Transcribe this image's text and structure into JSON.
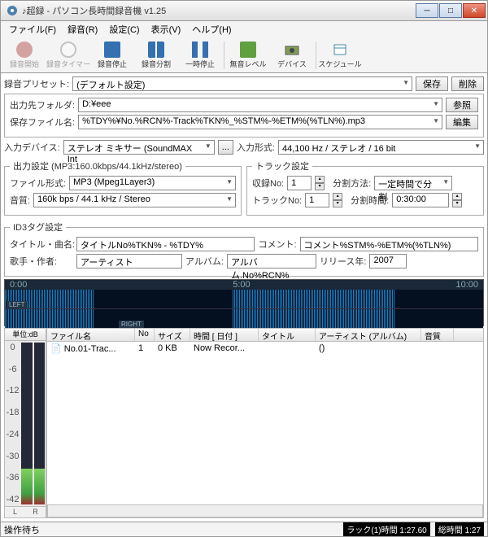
{
  "window": {
    "title": "♪超録 - パソコン長時間録音機 v1.25"
  },
  "menu": {
    "file": "ファイル(F)",
    "record": "録音(R)",
    "settings": "設定(C)",
    "view": "表示(V)",
    "help": "ヘルプ(H)"
  },
  "toolbar": {
    "rec_start": "録音開始",
    "rec_timer": "録音タイマー",
    "rec_stop": "録音停止",
    "rec_split": "録音分割",
    "pause": "一時停止",
    "silence": "無音レベル",
    "device": "デバイス",
    "schedule": "スケジュール"
  },
  "preset": {
    "label": "録音プリセット:",
    "value": "(デフォルト設定)",
    "save": "保存",
    "delete": "削除"
  },
  "output": {
    "folder_label": "出力先フォルダ:",
    "folder_value": "D:¥eee",
    "browse": "参照",
    "file_label": "保存ファイル名:",
    "file_value": "%TDY%¥No.%RCN%-Track%TKN%_%STM%-%ETM%(%TLN%).mp3",
    "edit": "編集"
  },
  "input": {
    "device_label": "入力デバイス:",
    "device_value": "ステレオ ミキサー (SoundMAX Int",
    "format_label": "入力形式:",
    "format_value": "44,100 Hz / ステレオ / 16 bit"
  },
  "outset": {
    "legend": "出力設定 (MP3:160.0kbps/44.1kHz/stereo)",
    "filetype_label": "ファイル形式:",
    "filetype_value": "MP3 (Mpeg1Layer3)",
    "quality_label": "音質:",
    "quality_value": "160k bps / 44.1 kHz / Stereo"
  },
  "trackset": {
    "legend": "トラック設定",
    "recno_label": "収録No:",
    "recno_value": "1",
    "split_label": "分割方法:",
    "split_value": "一定時間で分割",
    "trackno_label": "トラックNo:",
    "trackno_value": "1",
    "splittime_label": "分割時間:",
    "splittime_value": "0:30:00"
  },
  "id3": {
    "legend": "ID3タグ設定",
    "title_label": "タイトル・曲名:",
    "title_value": "タイトルNo%TKN% - %TDY%",
    "comment_label": "コメント:",
    "comment_value": "コメント%STM%-%ETM%(%TLN%)",
    "singer_label": "歌手・作者:",
    "singer_value": "アーティスト",
    "album_label": "アルバム:",
    "album_value": "アルバム.No%RCN%",
    "year_label": "リリース年:",
    "year_value": "2007"
  },
  "waveform": {
    "t0": "0:00",
    "t1": "5:00",
    "t2": "10:00",
    "left": "LEFT",
    "right": "RIGHT"
  },
  "meter": {
    "unit": "単位:dB",
    "scale": [
      "0",
      "-6",
      "-12",
      "-18",
      "-24",
      "-30",
      "-36",
      "-42"
    ],
    "L": "L",
    "R": "R"
  },
  "list": {
    "headers": {
      "name": "ファイル名",
      "no": "No",
      "size": "サイズ",
      "time": "時間 [ 日付 ]",
      "title": "タイトル",
      "artist": "アーティスト (アルバム)",
      "quality": "音質"
    },
    "rows": [
      {
        "name": "No.01-Trac...",
        "no": "1",
        "size": "0 KB",
        "time": "Now Recor...",
        "title": "",
        "artist": "()",
        "quality": ""
      }
    ]
  },
  "status": {
    "state": "操作待ち",
    "track": "ラック(1)時間 1:27.60",
    "total": "総時間 1:27"
  }
}
